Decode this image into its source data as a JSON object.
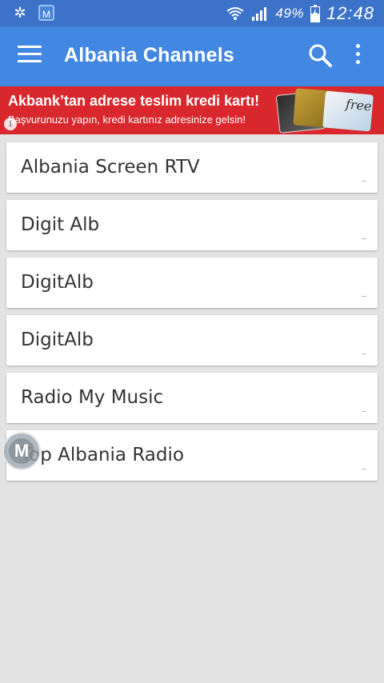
{
  "status_bar": {
    "icons_left": [
      "pinwheel-icon",
      "m-app-icon"
    ],
    "m_icon_label": "M",
    "battery_text": "49%",
    "time": "12:48"
  },
  "app_bar": {
    "title": "Albania Channels",
    "menu_icon": "hamburger-menu-icon",
    "search_icon": "search-icon",
    "more_icon": "more-vert-icon",
    "color": "#4287e2"
  },
  "ad": {
    "headline": "Akbank’tan adrese teslim kredi kartı!",
    "subline": "Başvurunuzu yapın, kredi kartınız adresinize gelsin!",
    "info_symbol": "i",
    "card_text": "free",
    "color": "#d9272e"
  },
  "channels": [
    {
      "label": "Albania Screen RTV"
    },
    {
      "label": "Digit Alb"
    },
    {
      "label": "DigitAlb"
    },
    {
      "label": "DigitAlb"
    },
    {
      "label": "Radio My Music"
    },
    {
      "label": "Top Albania Radio"
    }
  ],
  "floating_button": {
    "label": "M"
  }
}
